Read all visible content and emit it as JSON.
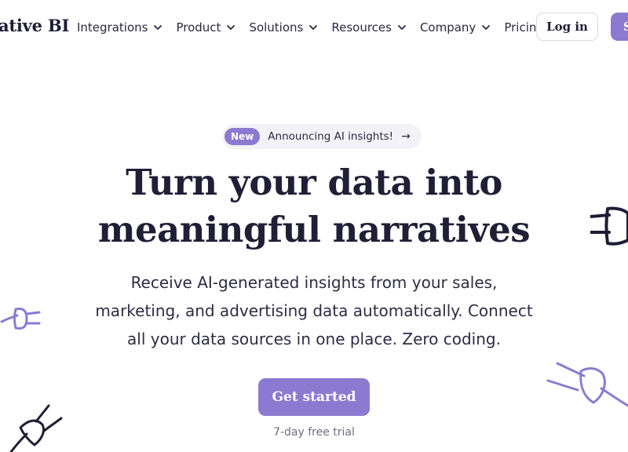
{
  "header": {
    "logo_text": "ative BI",
    "nav": [
      {
        "label": "Integrations",
        "has_dropdown": true
      },
      {
        "label": "Product",
        "has_dropdown": true
      },
      {
        "label": "Solutions",
        "has_dropdown": true
      },
      {
        "label": "Resources",
        "has_dropdown": true
      },
      {
        "label": "Company",
        "has_dropdown": true
      },
      {
        "label": "Pricing",
        "has_dropdown": false
      }
    ],
    "login_label": "Log in",
    "signup_label_partial": "S"
  },
  "announcement": {
    "badge": "New",
    "text": "Announcing AI insights!",
    "arrow": "→"
  },
  "hero": {
    "title_line1": "Turn your data into",
    "title_line2": "meaningful narratives",
    "subtitle_line1": "Receive AI-generated insights from your sales,",
    "subtitle_line2": "marketing, and advertising data automatically. Connect",
    "subtitle_line3": "all your data sources in one place. Zero coding.",
    "cta_label": "Get started",
    "trial_note": "7-day free trial"
  },
  "colors": {
    "accent": "#8b7bd0",
    "text_dark": "#1f1d35",
    "muted": "#6f6d80",
    "pill_bg": "#f3f2f7"
  },
  "icons": {
    "chevron": "chevron-down-icon",
    "plug": "plug-icon"
  }
}
